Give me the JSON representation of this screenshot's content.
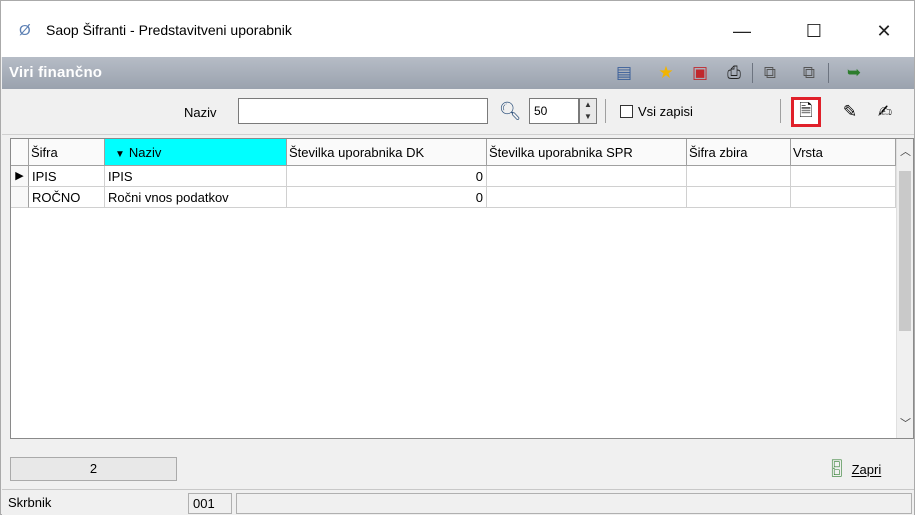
{
  "window": {
    "title": "Saop Šifranti - Predstavitveni uporabnik",
    "app_icon": "saop-logo-icon",
    "controls": {
      "minimize": "—",
      "maximize": "☐",
      "close": "✕"
    }
  },
  "module": {
    "title": "Viri finančno",
    "toolbar_icons": [
      "table-icon",
      "star-icon",
      "delete-doc-icon",
      "print-icon",
      "copy-icon",
      "paste-icon",
      "exit-icon"
    ]
  },
  "filter": {
    "label": "Naziv",
    "value": "",
    "count": "50",
    "checkbox_label": "Vsi zapisi",
    "checkbox_checked": false,
    "actions": [
      "new-record-icon",
      "edit-record-icon",
      "edit-multi-icon"
    ]
  },
  "grid": {
    "columns": [
      "Šifra",
      "Naziv",
      "Številka uporabnika DK",
      "Številka uporabnika SPR",
      "Šifra zbira",
      "Vrsta"
    ],
    "sorted_column": "Naziv",
    "rows": [
      {
        "sifra": "IPIS",
        "naziv": "IPIS",
        "dk": "0",
        "spr": "",
        "zbira": "",
        "vrsta": ""
      },
      {
        "sifra": "ROČNO",
        "naziv": "Ročni vnos podatkov",
        "dk": "0",
        "spr": "",
        "zbira": "",
        "vrsta": ""
      }
    ],
    "current_row_marker": "▶"
  },
  "footer": {
    "record_count": "2",
    "close_label": "Zapri"
  },
  "statusbar": {
    "field1": "Skrbnik",
    "field2": "001",
    "field3": ""
  }
}
